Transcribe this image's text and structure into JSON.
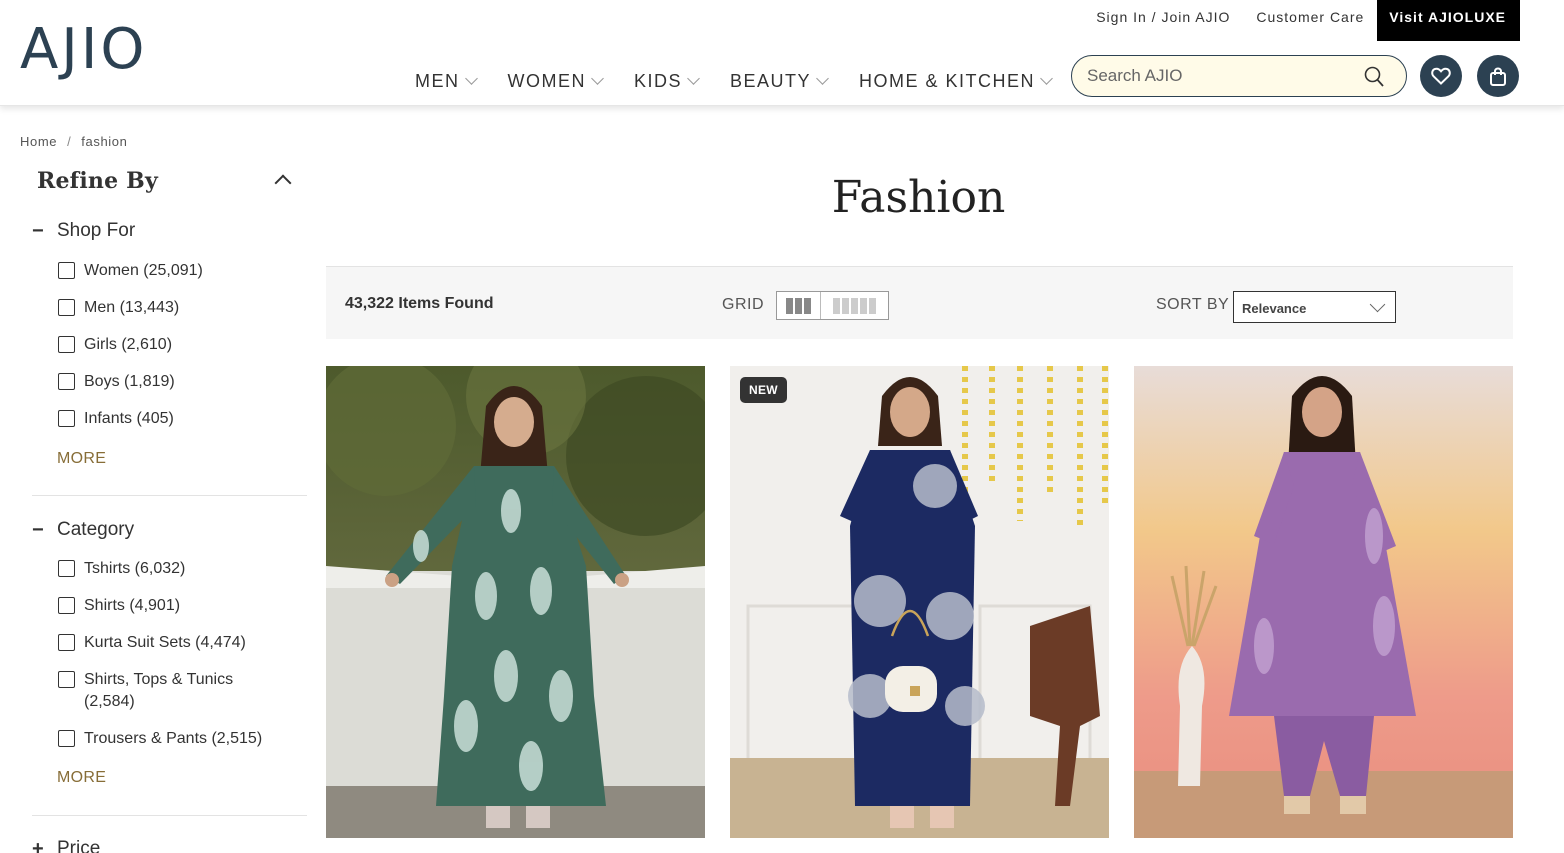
{
  "header": {
    "logo": "AJIO",
    "sign_in": "Sign In / Join AJIO",
    "customer_care": "Customer Care",
    "luxe": "Visit AJIOLUXE",
    "nav": [
      "MEN",
      "WOMEN",
      "KIDS",
      "BEAUTY",
      "HOME & KITCHEN"
    ],
    "search_placeholder": "Search AJIO",
    "brand_color": "#2c4152"
  },
  "breadcrumb": [
    "Home",
    "fashion"
  ],
  "sidebar": {
    "title": "Refine By",
    "shop_for": {
      "label": "Shop For",
      "items": [
        "Women (25,091)",
        "Men (13,443)",
        "Girls (2,610)",
        "Boys (1,819)",
        "Infants (405)"
      ],
      "more": "MORE"
    },
    "category": {
      "label": "Category",
      "items": [
        "Tshirts (6,032)",
        "Shirts (4,901)",
        "Kurta Suit Sets (4,474)",
        "Shirts, Tops & Tunics (2,584)",
        "Trousers & Pants (2,515)"
      ],
      "more": "MORE"
    },
    "price": {
      "label": "Price"
    }
  },
  "main": {
    "title": "Fashion",
    "items_found": "43,322 Items Found",
    "grid_label": "GRID",
    "sort_label": "SORT BY",
    "sort_value": "Relevance"
  },
  "products": [
    {
      "badge": "",
      "image": "woman-green-printed-kurta-set",
      "color": "#3f6b5c"
    },
    {
      "badge": "NEW",
      "image": "woman-navy-floral-kurta-set",
      "color": "#1c2a62"
    },
    {
      "badge": "",
      "image": "woman-lavender-embroidered-kurta-set",
      "color": "#9a6bae"
    }
  ]
}
